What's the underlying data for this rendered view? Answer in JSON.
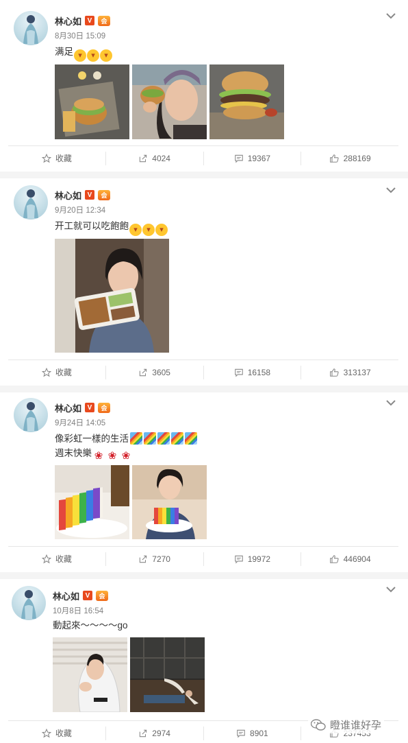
{
  "user": {
    "name": "林心如",
    "verified_badge": "V",
    "vip_badge": "会"
  },
  "labels": {
    "collect": "收藏"
  },
  "posts": [
    {
      "time": "8月30日 15:09",
      "text": "满足",
      "text2": "",
      "stats": {
        "repost": "4024",
        "comment": "19367",
        "like": "288169"
      },
      "images": [
        "burger-fries-plate",
        "selfie-eating-burger",
        "burger-closeup"
      ]
    },
    {
      "time": "9月20日 12:34",
      "text": "开工就可以吃飽飽",
      "text2": "",
      "stats": {
        "repost": "3605",
        "comment": "16158",
        "like": "313137"
      },
      "images": [
        "woman-with-lunchbox"
      ]
    },
    {
      "time": "9月24日 14:05",
      "text": "像彩虹一樣的生活",
      "text2": "週末快樂",
      "stats": {
        "repost": "7270",
        "comment": "19972",
        "like": "446904"
      },
      "images": [
        "rainbow-cake",
        "woman-with-rainbow-cake"
      ]
    },
    {
      "time": "10月8日 16:54",
      "text": "動起來～～～～go",
      "text2": "",
      "stats": {
        "repost": "2974",
        "comment": "8901",
        "like": "237453"
      },
      "images": [
        "woman-white-hoodie",
        "yoga-studio"
      ]
    }
  ],
  "watermark": {
    "text": "瞪谁谁好孕"
  },
  "colors": {
    "accent": "#e8491d",
    "text": "#333333",
    "muted": "#808080",
    "divider": "#e6e6e6"
  }
}
